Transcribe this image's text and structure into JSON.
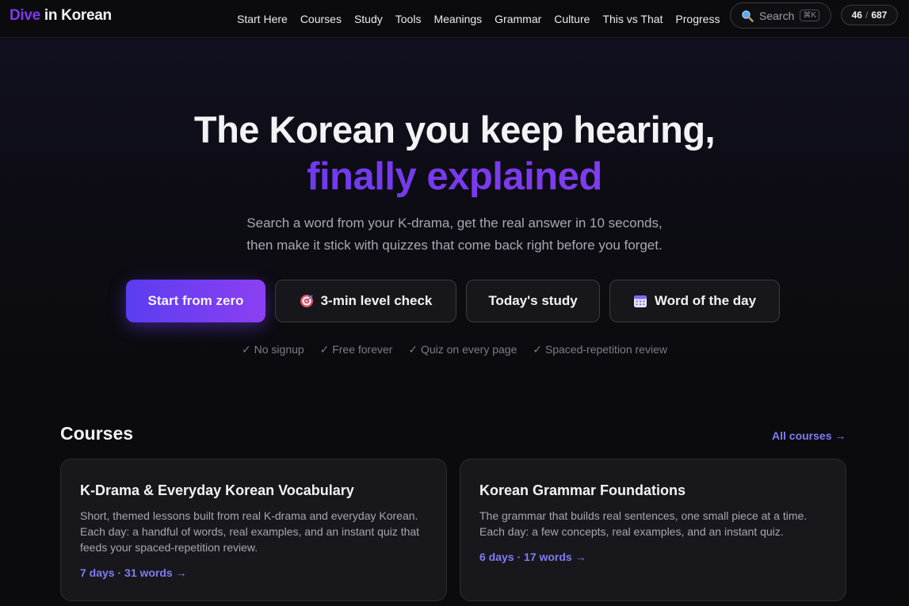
{
  "nav": {
    "logo_part1": "Dive",
    "logo_part2": " in Korean",
    "links": [
      "Start Here",
      "Courses",
      "Study",
      "Tools",
      "Meanings",
      "Grammar",
      "Culture",
      "This vs That",
      "Progress"
    ],
    "search_label": "Search",
    "search_shortcut": "⌘K",
    "progress_done": "46",
    "progress_sep": "/",
    "progress_total": "687"
  },
  "hero": {
    "headline": "The Korean you keep hearing,",
    "headline_accent": "finally explained",
    "subtitle_line1": "Search a word from your K-drama, get the real answer in 10 seconds,",
    "subtitle_line2": "then make it stick with quizzes that come back right before you forget.",
    "buttons": {
      "start": "Start from zero",
      "level_check": "3-min level check",
      "today": "Today's study",
      "word_of_day": "Word of the day"
    },
    "checks": [
      "✓ No signup",
      "✓ Free forever",
      "✓ Quiz on every page",
      "✓ Spaced-repetition review"
    ]
  },
  "courses": {
    "title": "Courses",
    "all_link": "All courses →",
    "cards": [
      {
        "title": "K-Drama & Everyday Korean Vocabulary",
        "description": "Short, themed lessons built from real K-drama and everyday Korean.\nEach day: a handful of words, real examples, and an instant quiz that\nfeeds your spaced-repetition review.",
        "meta": "7 days · 31 words →"
      },
      {
        "title": "Korean Grammar Foundations",
        "description": "The grammar that builds real sentences, one small piece at a time.\nEach day: a few concepts, real examples, and an instant quiz.",
        "meta": "6 days · 17 words →"
      }
    ]
  },
  "icons": {
    "search": "magnifier-icon",
    "level_check": "target-icon",
    "word_of_day": "calendar-icon"
  },
  "colors": {
    "accent": "#7c3aed",
    "link": "#7f7cf5",
    "background": "#0b0b0e",
    "card": "#18181c"
  }
}
